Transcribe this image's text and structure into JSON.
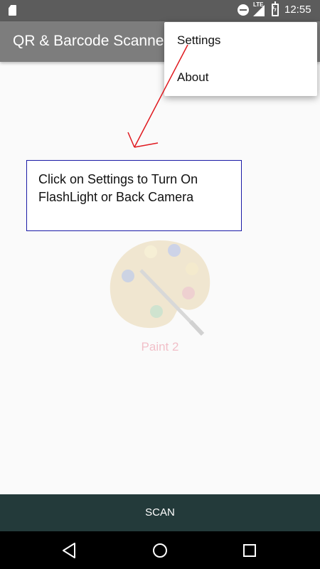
{
  "status_bar": {
    "time": "12:55",
    "network": "LTE",
    "icons": [
      "sd-card-icon",
      "do-not-disturb-icon",
      "lte-signal-icon",
      "battery-charging-icon"
    ]
  },
  "app_bar": {
    "title": "QR & Barcode Scanne"
  },
  "menu": {
    "items": [
      {
        "label": "Settings"
      },
      {
        "label": "About"
      }
    ]
  },
  "hint": {
    "text": "Click on Settings to Turn On FlashLight or Back Camera",
    "border_color": "#1a1aa6",
    "arrow_color": "#e0191f"
  },
  "placeholder": {
    "icon": "paint-palette-icon",
    "label": "Paint 2"
  },
  "bottom": {
    "scan_label": "SCAN",
    "bar_color": "#233a3a"
  },
  "nav": {
    "icons": [
      "back-icon",
      "home-icon",
      "recents-icon"
    ]
  }
}
